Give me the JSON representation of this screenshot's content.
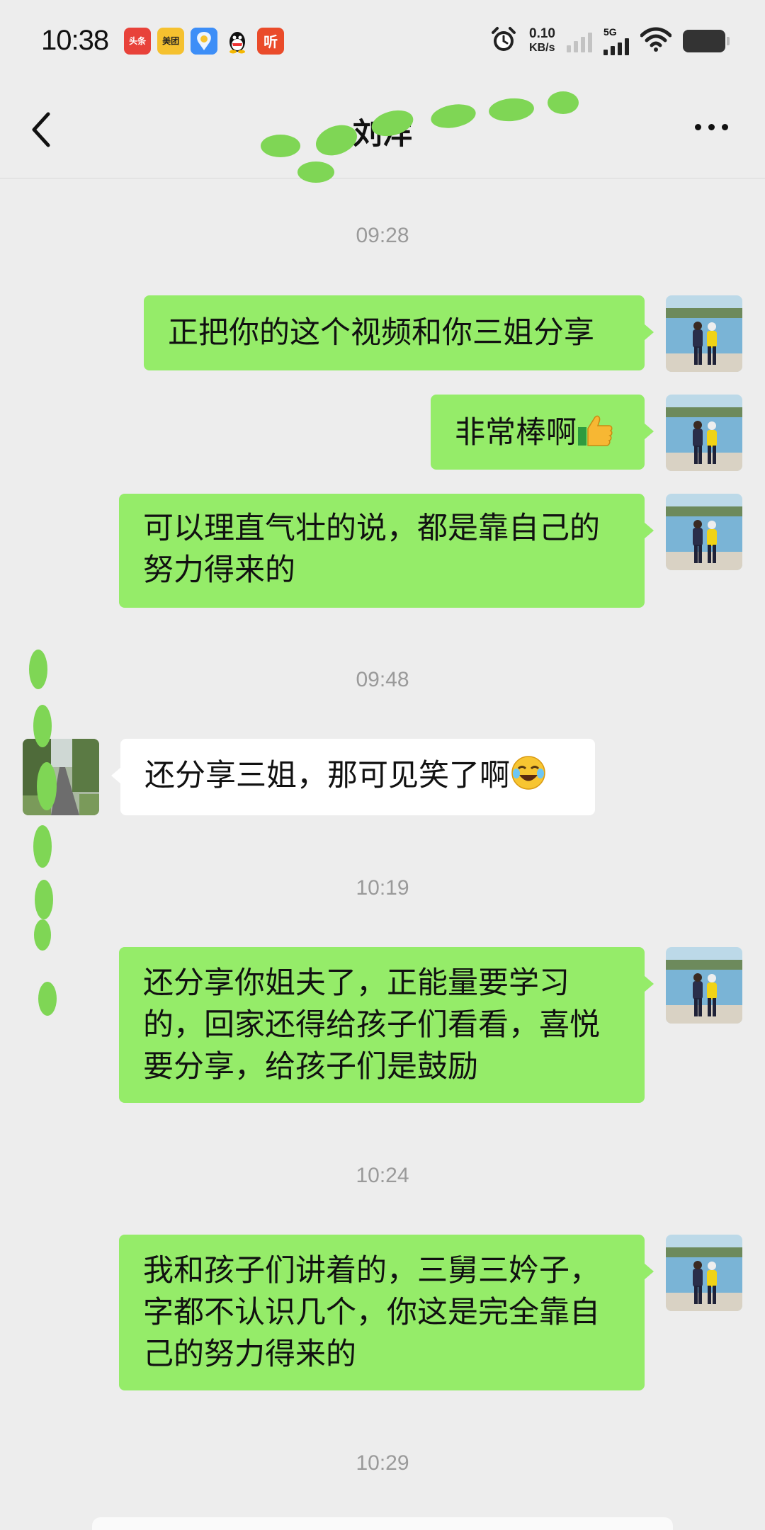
{
  "status_bar": {
    "time": "10:38",
    "apps": [
      {
        "name": "toutiao-icon",
        "label": "头条",
        "color": "#e8423a"
      },
      {
        "name": "meituan-icon",
        "label": "美团",
        "color": "#f5c12f"
      },
      {
        "name": "files-icon",
        "label": "",
        "color": "#3d8ef7"
      },
      {
        "name": "qq-icon",
        "label": "",
        "color": "#ffffff"
      },
      {
        "name": "ting-icon",
        "label": "听",
        "color": "#ea4b2a"
      }
    ],
    "net_speed_value": "0.10",
    "net_speed_unit": "KB/s",
    "network": "5G"
  },
  "header": {
    "title": "刘洋"
  },
  "messages": [
    {
      "type": "time",
      "text": "09:28"
    },
    {
      "type": "out",
      "text": "正把你的这个视频和你三姐分享"
    },
    {
      "type": "out",
      "text": "非常棒啊",
      "emoji": "thumbs-up"
    },
    {
      "type": "out",
      "lines": [
        "可以理直气壮的说，都是靠自己的",
        "努力得来的"
      ]
    },
    {
      "type": "time",
      "text": "09:48"
    },
    {
      "type": "in",
      "text": "还分享三姐，那可见笑了啊",
      "emoji": "rolling-laugh"
    },
    {
      "type": "time",
      "text": "10:19"
    },
    {
      "type": "out",
      "lines": [
        "还分享你姐夫了，正能量要学习",
        "的，回家还得给孩子们看看，喜悦",
        "要分享，给孩子们是鼓励"
      ]
    },
    {
      "type": "time",
      "text": "10:24"
    },
    {
      "type": "out",
      "lines": [
        "我和孩子们讲着的，三舅三妗子，",
        "字都不认识几个，你这是完全靠自",
        "己的努力得来的"
      ]
    },
    {
      "type": "time",
      "text": "10:29"
    }
  ],
  "colors": {
    "background": "#ededed",
    "outgoing_bubble": "#95ec69",
    "incoming_bubble": "#ffffff",
    "timestamp": "#9a9a9a",
    "scribble": "#7fd655"
  }
}
